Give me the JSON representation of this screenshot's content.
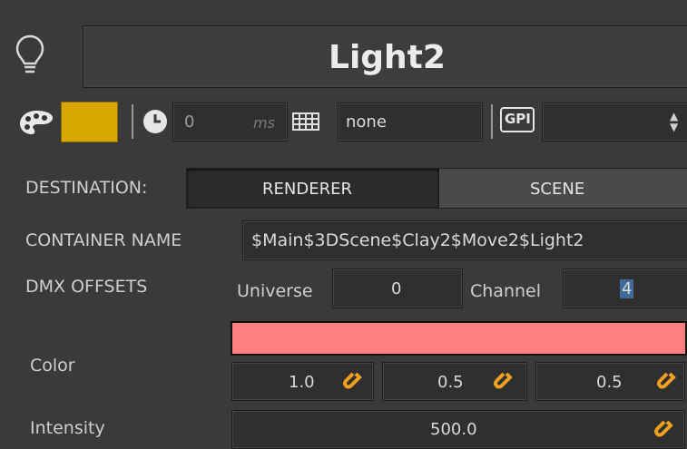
{
  "header": {
    "title": "Light2",
    "icon": "lightbulb-icon"
  },
  "toolbar": {
    "color_swatch": "#D9A800",
    "delay_value": "0",
    "delay_unit": "ms",
    "keyframe_value": "none",
    "gpi_label": "GPI",
    "gpi_select_value": ""
  },
  "destination": {
    "label": "DESTINATION:",
    "options": [
      "RENDERER",
      "SCENE"
    ],
    "selected": "RENDERER"
  },
  "container": {
    "label": "CONTAINER NAME",
    "value": "$Main$3DScene$Clay2$Move2$Light2"
  },
  "dmx": {
    "label": "DMX OFFSETS",
    "universe_label": "Universe",
    "universe_value": "0",
    "channel_label": "Channel",
    "channel_value": "4"
  },
  "color": {
    "label": "Color",
    "swatch": "#FF7F7F",
    "r": "1.0",
    "g": "0.5",
    "b": "0.5"
  },
  "intensity": {
    "label": "Intensity",
    "value": "500.0"
  },
  "colors": {
    "background": "#3a3a3a",
    "accent_orange": "#F0A020"
  }
}
